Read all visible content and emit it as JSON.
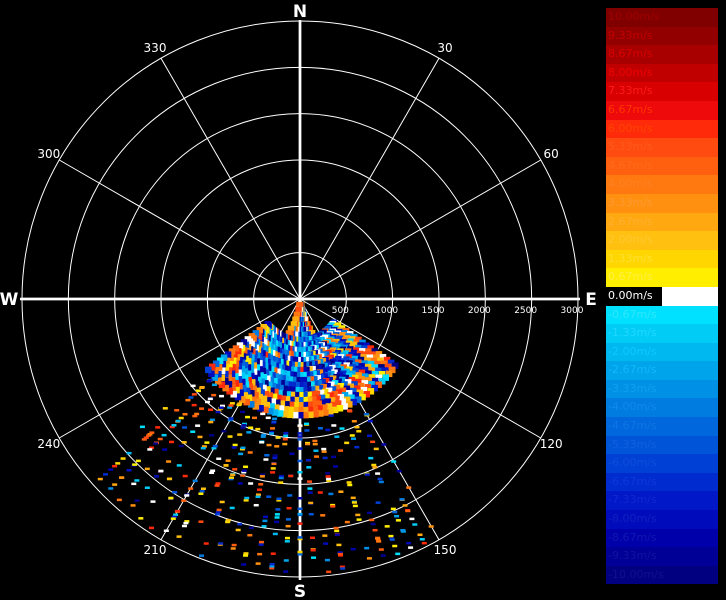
{
  "compass": {
    "north": "N",
    "south": "S",
    "east": "E",
    "west": "W",
    "angles": [
      {
        "deg": 30,
        "label": "30"
      },
      {
        "deg": 60,
        "label": "60"
      },
      {
        "deg": 120,
        "label": "120"
      },
      {
        "deg": 150,
        "label": "150"
      },
      {
        "deg": 210,
        "label": "210"
      },
      {
        "deg": 240,
        "label": "240"
      },
      {
        "deg": 300,
        "label": "300"
      },
      {
        "deg": 330,
        "label": "330"
      }
    ]
  },
  "range_labels": [
    "500",
    "1000",
    "1500",
    "2000",
    "2500",
    "3000"
  ],
  "range_rings": [
    500,
    1000,
    1500,
    2000,
    2500,
    3000
  ],
  "scan": {
    "near_sector_deg": [
      125,
      235
    ],
    "far_sector_deg": [
      150,
      230
    ]
  },
  "colors": {
    "background": "#000000",
    "grid": "#ffffff",
    "zero": "#ffffff"
  },
  "colorbar": [
    {
      "label": "10.00m/s",
      "color": "#800000",
      "text": "#a00000"
    },
    {
      "label": "9.33m/s",
      "color": "#930000",
      "text": "#c00000"
    },
    {
      "label": "8.67m/s",
      "color": "#a80000",
      "text": "#d80000"
    },
    {
      "label": "8.00m/s",
      "color": "#c00000",
      "text": "#f00000"
    },
    {
      "label": "7.33m/s",
      "color": "#d80000",
      "text": "#ff1a1a"
    },
    {
      "label": "6.67m/s",
      "color": "#ee0a0a",
      "text": "#ff3300"
    },
    {
      "label": "6.00m/s",
      "color": "#ff2a0a",
      "text": "#ff4400"
    },
    {
      "label": "5.33m/s",
      "color": "#ff4a10",
      "text": "#ff5a1a"
    },
    {
      "label": "4.67m/s",
      "color": "#ff6010",
      "text": "#ff6a1a"
    },
    {
      "label": "4.00m/s",
      "color": "#ff7810",
      "text": "#ff8020"
    },
    {
      "label": "3.33m/s",
      "color": "#ff9010",
      "text": "#ff9a30"
    },
    {
      "label": "2.67m/s",
      "color": "#ffa810",
      "text": "#ffb030"
    },
    {
      "label": "2.00m/s",
      "color": "#ffc010",
      "text": "#ffc830"
    },
    {
      "label": "1.33m/s",
      "color": "#ffd600",
      "text": "#ffe030"
    },
    {
      "label": "0.67m/s",
      "color": "#ffee00",
      "text": "#fff040"
    },
    {
      "label": "0.00m/s",
      "color": "#ffffff",
      "text": "#ffffff",
      "zero": true
    },
    {
      "label": "-0.67m/s",
      "color": "#00e0ff",
      "text": "#30e8ff"
    },
    {
      "label": "-1.33m/s",
      "color": "#00ccf5",
      "text": "#20d8ff"
    },
    {
      "label": "-2.00m/s",
      "color": "#00b8f0",
      "text": "#10c8ff"
    },
    {
      "label": "-2.67m/s",
      "color": "#00a4ea",
      "text": "#10b8f8"
    },
    {
      "label": "-3.33m/s",
      "color": "#0090e5",
      "text": "#10a0f0"
    },
    {
      "label": "-4.00m/s",
      "color": "#007ce0",
      "text": "#1088ea"
    },
    {
      "label": "-4.67m/s",
      "color": "#0068dc",
      "text": "#1074e4"
    },
    {
      "label": "-5.33m/s",
      "color": "#0054d8",
      "text": "#1060e0"
    },
    {
      "label": "-6.00m/s",
      "color": "#0040d4",
      "text": "#104cdc"
    },
    {
      "label": "-6.67m/s",
      "color": "#002ccf",
      "text": "#1038d8"
    },
    {
      "label": "-7.33m/s",
      "color": "#0018c8",
      "text": "#1028d0"
    },
    {
      "label": "-8.00m/s",
      "color": "#000cbb",
      "text": "#1020c0"
    },
    {
      "label": "-8.67m/s",
      "color": "#0000aa",
      "text": "#1018b0"
    },
    {
      "label": "-9.33m/s",
      "color": "#000096",
      "text": "#1014a0"
    },
    {
      "label": "-10.00m/s",
      "color": "#000080",
      "text": "#101090"
    }
  ]
}
